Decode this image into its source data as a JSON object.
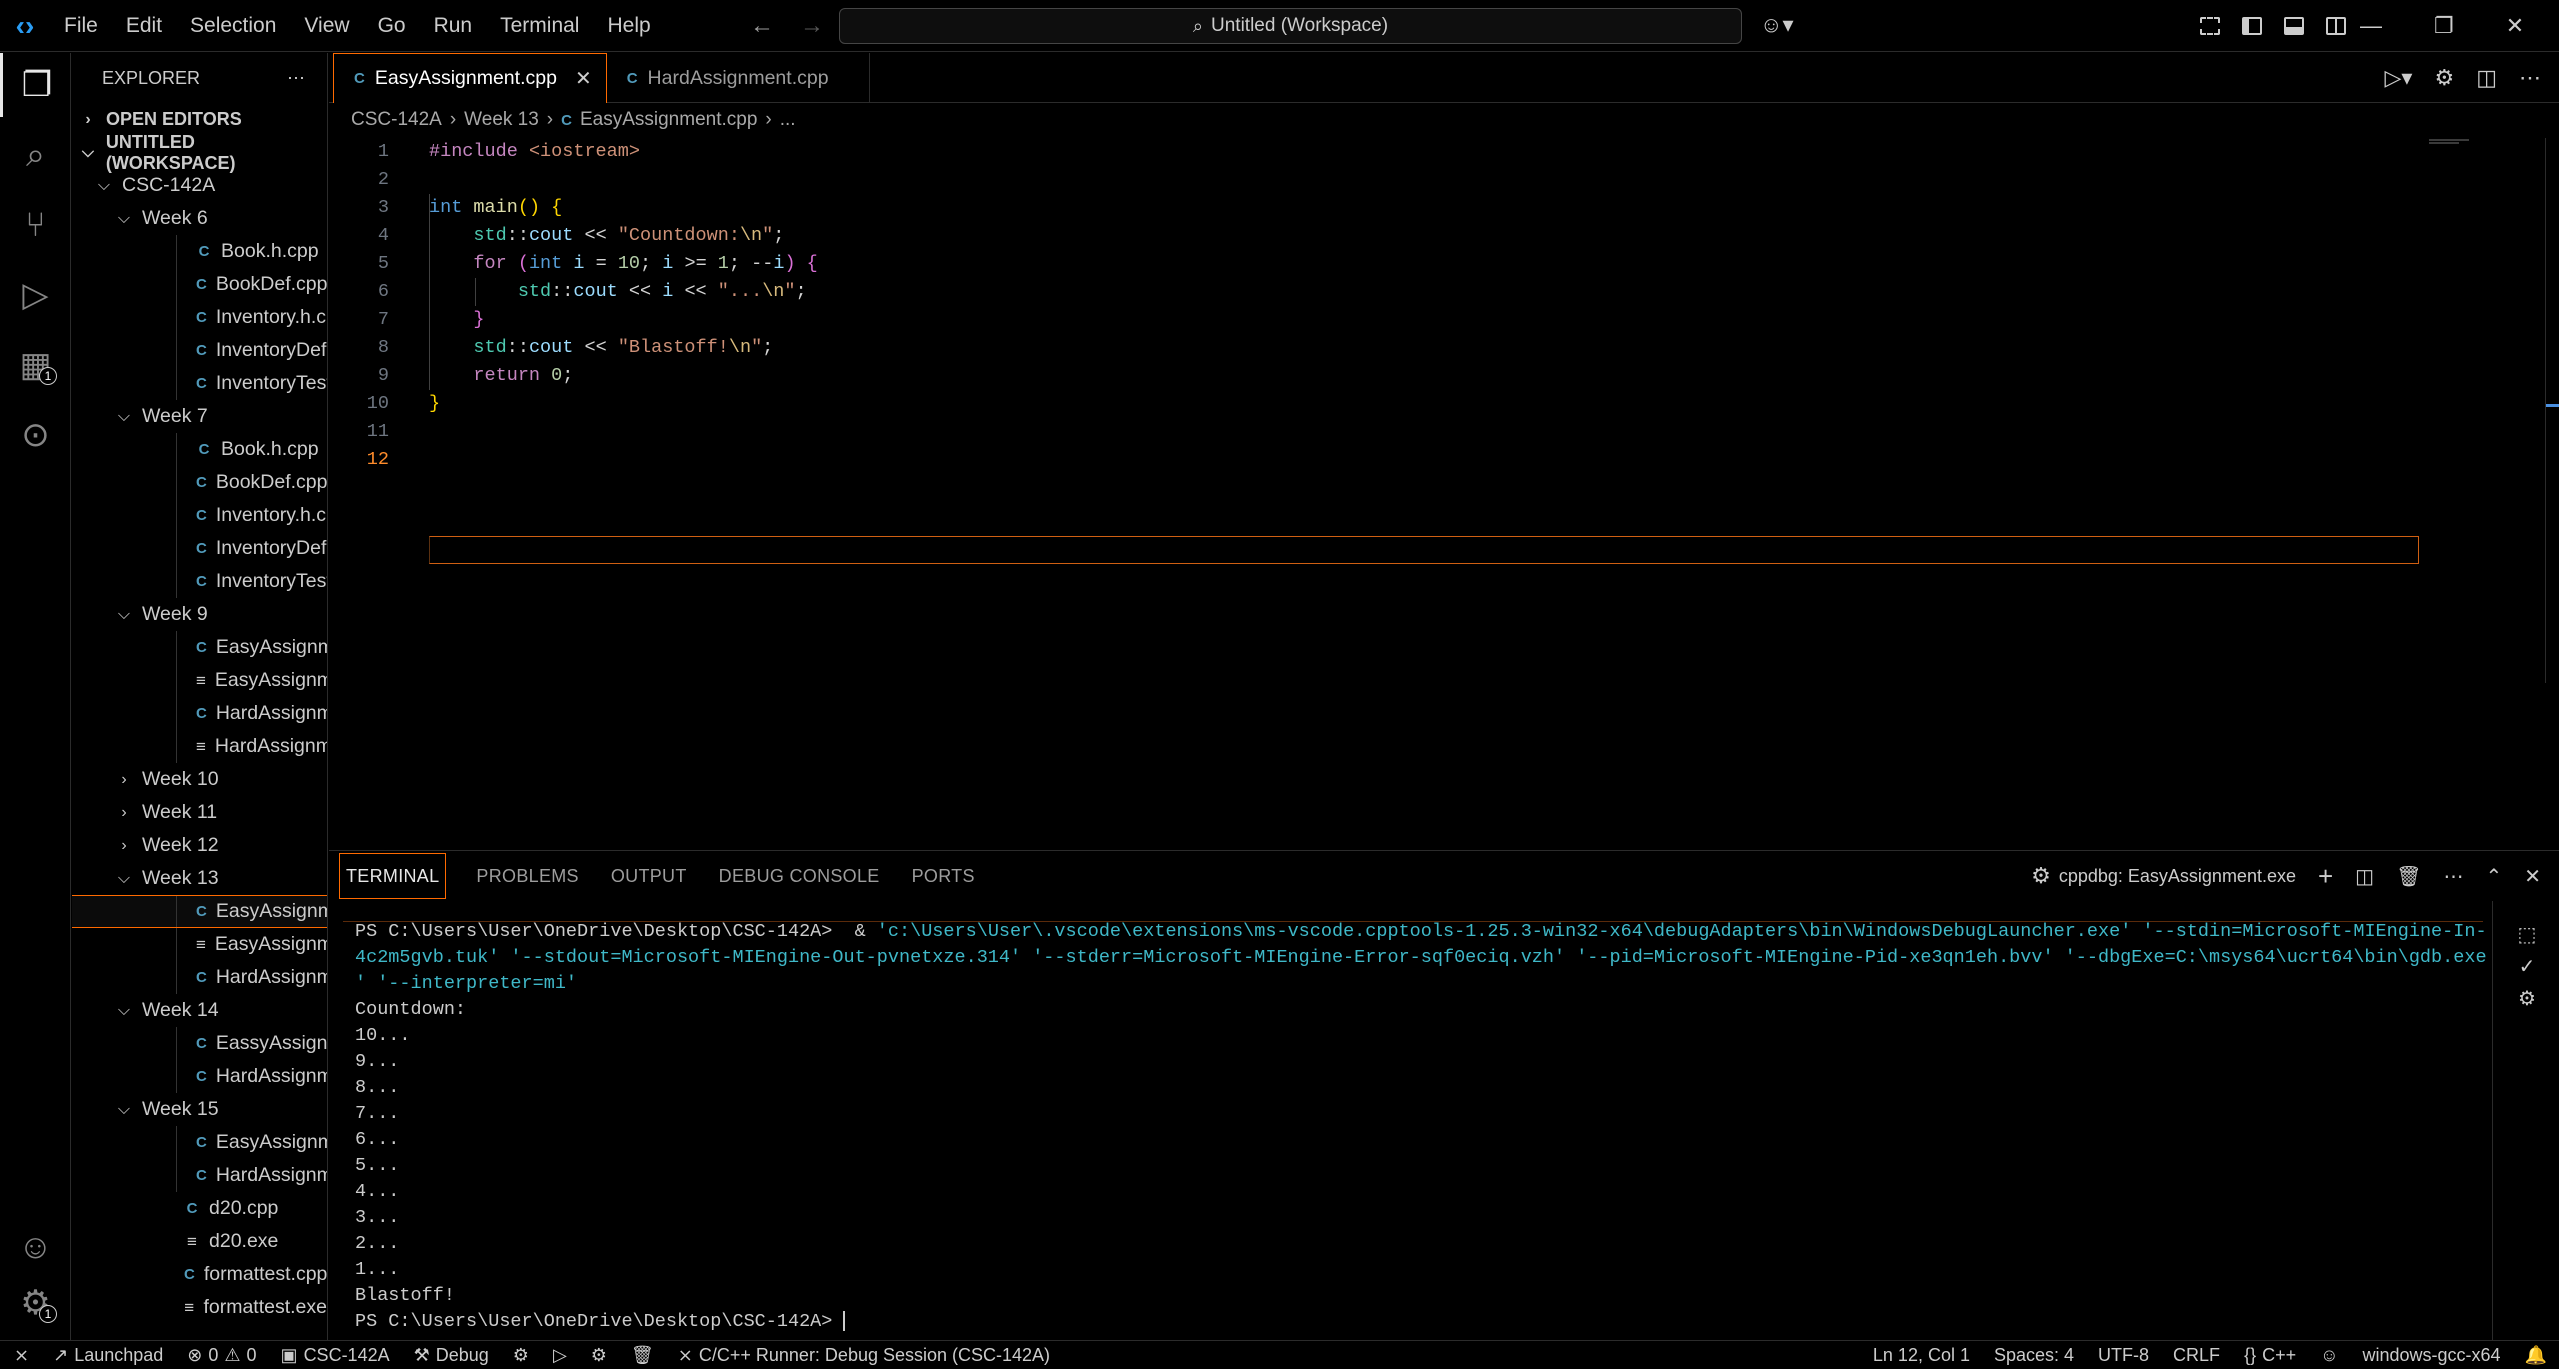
{
  "titlebar": {
    "menu": [
      "File",
      "Edit",
      "Selection",
      "View",
      "Go",
      "Run",
      "Terminal",
      "Help"
    ],
    "search": "Untitled (Workspace)"
  },
  "activity": {
    "extensions_badge": "1",
    "settings_badge": "1"
  },
  "sidebar": {
    "title": "EXPLORER",
    "open_editors": "OPEN EDITORS",
    "workspace": "UNTITLED (WORKSPACE)",
    "root_folder": "CSC-142A",
    "tree": [
      {
        "label": "Week 6",
        "type": "folder",
        "open": true,
        "depth": 1
      },
      {
        "label": "Book.h.cpp",
        "type": "cpp",
        "depth": 2
      },
      {
        "label": "BookDef.cpp",
        "type": "cpp",
        "depth": 2
      },
      {
        "label": "Inventory.h.cpp",
        "type": "cpp",
        "depth": 2
      },
      {
        "label": "InventoryDef.cpp",
        "type": "cpp",
        "depth": 2
      },
      {
        "label": "InventoryTester.cpp",
        "type": "cpp",
        "depth": 2
      },
      {
        "label": "Week 7",
        "type": "folder",
        "open": true,
        "depth": 1
      },
      {
        "label": "Book.h.cpp",
        "type": "cpp",
        "depth": 2
      },
      {
        "label": "BookDef.cpp",
        "type": "cpp",
        "depth": 2
      },
      {
        "label": "Inventory.h.cpp",
        "type": "cpp",
        "depth": 2
      },
      {
        "label": "InventoryDef.cpp",
        "type": "cpp",
        "depth": 2
      },
      {
        "label": "InventoryTester.cpp",
        "type": "cpp",
        "depth": 2
      },
      {
        "label": "Week 9",
        "type": "folder",
        "open": true,
        "depth": 1
      },
      {
        "label": "EasyAssignment.cpp",
        "type": "cpp",
        "depth": 2
      },
      {
        "label": "EasyAssignment.exe",
        "type": "exe",
        "depth": 2
      },
      {
        "label": "HardAssignment.c...",
        "type": "cpp",
        "depth": 2
      },
      {
        "label": "HardAssignment.exe",
        "type": "exe",
        "depth": 2
      },
      {
        "label": "Week 10",
        "type": "folder",
        "open": false,
        "depth": 1
      },
      {
        "label": "Week 11",
        "type": "folder",
        "open": false,
        "depth": 1
      },
      {
        "label": "Week 12",
        "type": "folder",
        "open": false,
        "depth": 1
      },
      {
        "label": "Week 13",
        "type": "folder",
        "open": true,
        "depth": 1
      },
      {
        "label": "EasyAssignment.cpp",
        "type": "cpp",
        "depth": 2,
        "selected": true
      },
      {
        "label": "EasyAssignment.exe",
        "type": "exe",
        "depth": 2
      },
      {
        "label": "HardAssignment.c...",
        "type": "cpp",
        "depth": 2
      },
      {
        "label": "Week 14",
        "type": "folder",
        "open": true,
        "depth": 1
      },
      {
        "label": "EassyAssignment.c...",
        "type": "cpp",
        "depth": 2
      },
      {
        "label": "HardAssignment.c...",
        "type": "cpp",
        "depth": 2
      },
      {
        "label": "Week 15",
        "type": "folder",
        "open": true,
        "depth": 1
      },
      {
        "label": "EasyAssignment.cpp",
        "type": "cpp",
        "depth": 2
      },
      {
        "label": "HardAssignment.c...",
        "type": "cpp",
        "depth": 2
      },
      {
        "label": "d20.cpp",
        "type": "cpp",
        "depth": 1
      },
      {
        "label": "d20.exe",
        "type": "exe",
        "depth": 1
      },
      {
        "label": "formattest.cpp",
        "type": "cpp",
        "depth": 1
      },
      {
        "label": "formattest.exe",
        "type": "exe",
        "depth": 1
      }
    ]
  },
  "editor": {
    "tabs": [
      {
        "label": "EasyAssignment.cpp",
        "active": true
      },
      {
        "label": "HardAssignment.cpp",
        "active": false
      }
    ],
    "breadcrumb": [
      "CSC-142A",
      "Week 13",
      "EasyAssignment.cpp",
      "..."
    ],
    "line_numbers": [
      "1",
      "2",
      "3",
      "4",
      "5",
      "6",
      "7",
      "8",
      "9",
      "10",
      "11",
      "12"
    ]
  },
  "panel": {
    "tabs": [
      "TERMINAL",
      "PROBLEMS",
      "OUTPUT",
      "DEBUG CONSOLE",
      "PORTS"
    ],
    "session": "cppdbg: EasyAssignment.exe",
    "terminal": {
      "prompt1": "PS C:\\Users\\User\\OneDrive\\Desktop\\CSC-142A>  & ",
      "cmd_line1": "'c:\\Users\\User\\.vscode\\extensions\\ms-vscode.cpptools-1.25.3-win32-x64\\debugAdapters\\bin\\WindowsDebugLauncher.exe' '--stdin=Microsoft-MIEngine-In-",
      "cmd_line2": "4c2m5gvb.tuk' '--stdout=Microsoft-MIEngine-Out-pvnetxze.314' '--stderr=Microsoft-MIEngine-Error-sqf0eciq.vzh' '--pid=Microsoft-MIEngine-Pid-xe3qn1eh.bvv' '--dbgExe=C:\\msys64\\ucrt64\\bin\\gdb.exe",
      "cmd_line3": "' '--interpreter=mi'",
      "output": [
        "Countdown:",
        "10...",
        "9...",
        "8...",
        "7...",
        "6...",
        "5...",
        "4...",
        "3...",
        "2...",
        "1...",
        "Blastoff!"
      ],
      "prompt2": "PS C:\\Users\\User\\OneDrive\\Desktop\\CSC-142A> "
    }
  },
  "statusbar": {
    "launchpad": "Launchpad",
    "errors": "0",
    "warnings": "0",
    "folder": "CSC-142A",
    "debug": "Debug",
    "runner": "C/C++ Runner: Debug Session (CSC-142A)",
    "position": "Ln 12, Col 1",
    "spaces": "Spaces: 4",
    "encoding": "UTF-8",
    "eol": "CRLF",
    "language": "C++",
    "compiler": "windows-gcc-x64"
  },
  "colors": {
    "accent_border": "#ff6a00",
    "cpp_icon": "#519aba",
    "terminal_cmd": "#3fb8c8"
  }
}
